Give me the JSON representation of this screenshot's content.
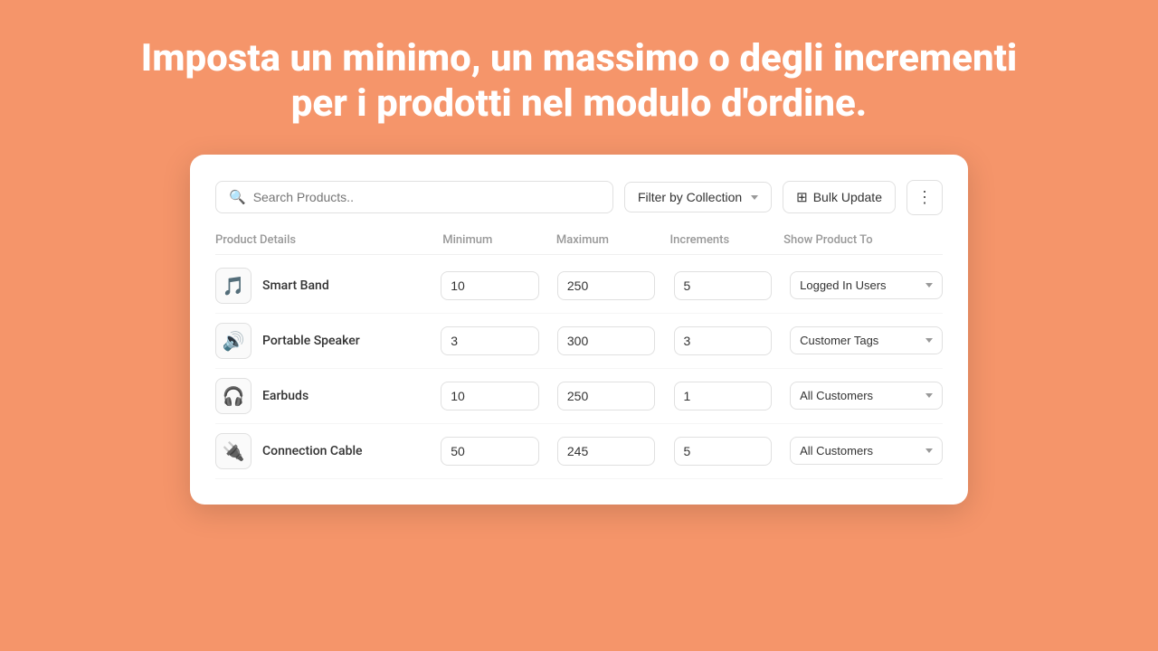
{
  "hero": {
    "text": "Imposta un minimo, un massimo o degli incrementi per i prodotti nel modulo d'ordine."
  },
  "toolbar": {
    "search_placeholder": "Search Products..",
    "filter_label": "Filter by Collection",
    "bulk_label": "Bulk Update",
    "more_icon": "⋮"
  },
  "table": {
    "headers": [
      "Product Details",
      "Minimum",
      "Maximum",
      "Increments",
      "Show Product To"
    ],
    "rows": [
      {
        "name": "Smart Band",
        "icon": "🎵",
        "minimum": "10",
        "maximum": "250",
        "increments": "5",
        "show_to": "Logged In Users"
      },
      {
        "name": "Portable Speaker",
        "icon": "🔊",
        "minimum": "3",
        "maximum": "300",
        "increments": "3",
        "show_to": "Customer Tags"
      },
      {
        "name": "Earbuds",
        "icon": "🎧",
        "minimum": "10",
        "maximum": "250",
        "increments": "1",
        "show_to": "All Customers"
      },
      {
        "name": "Connection Cable",
        "icon": "🔌",
        "minimum": "50",
        "maximum": "245",
        "increments": "5",
        "show_to": "All Customers"
      }
    ]
  }
}
